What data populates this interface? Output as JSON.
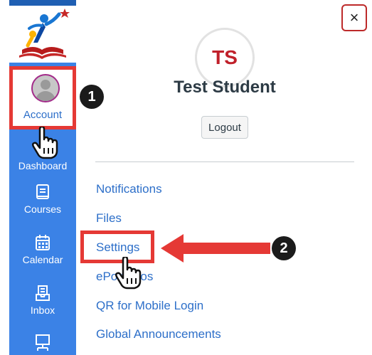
{
  "sidebar": {
    "account_label": "Account",
    "items": [
      {
        "label": "Dashboard",
        "icon": "dashboard-icon"
      },
      {
        "label": "Courses",
        "icon": "courses-icon"
      },
      {
        "label": "Calendar",
        "icon": "calendar-icon"
      },
      {
        "label": "Inbox",
        "icon": "inbox-icon"
      },
      {
        "label": "",
        "icon": "commons-icon"
      }
    ]
  },
  "tray": {
    "initials": "TS",
    "user_name": "Test Student",
    "logout_label": "Logout",
    "close_label": "×",
    "links": [
      "Notifications",
      "Files",
      "Settings",
      "ePortfolios",
      "QR for Mobile Login",
      "Global Announcements"
    ],
    "visible_partial_link": "ePortfolios"
  },
  "annotations": {
    "step1": "1",
    "step2": "2"
  },
  "colors": {
    "sidebar": "#3b82e6",
    "highlight": "#e53935",
    "link": "#2d6fc9",
    "initials": "#c0202a"
  }
}
